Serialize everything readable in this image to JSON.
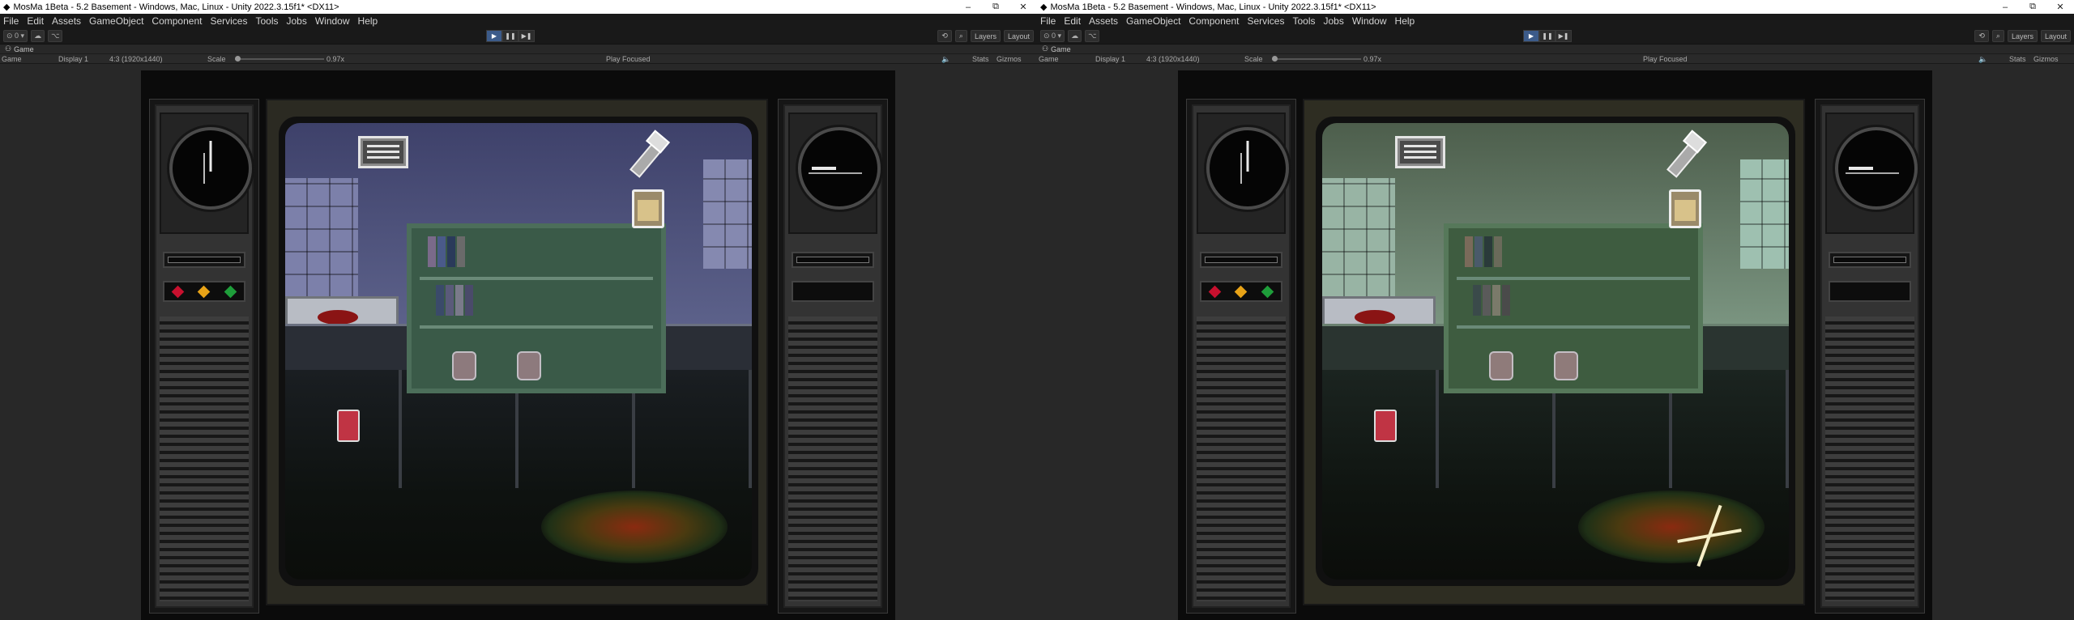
{
  "left": {
    "window_title": "MosMa 1Beta - 5.2 Basement - Windows, Mac, Linux - Unity 2022.3.15f1* <DX11>",
    "game_tab": "Game",
    "variant": "cold"
  },
  "right": {
    "window_title": "MosMa 1Beta - 5.2 Basement - Windows, Mac, Linux - Unity 2022.3.15f1* <DX11>",
    "game_tab": "Game",
    "variant": "green"
  },
  "window_controls": {
    "minimize": "–",
    "restore": "⧉",
    "close": "✕"
  },
  "menu": [
    "File",
    "Edit",
    "Assets",
    "GameObject",
    "Component",
    "Services",
    "Tools",
    "Jobs",
    "Window",
    "Help"
  ],
  "toolbar": {
    "account": "⊙ 0 ▾",
    "cloud": "☁",
    "layers": "Layers",
    "layout": "Layout"
  },
  "playbar": {
    "play": "▶",
    "pause": "❚❚",
    "step": "▶❚"
  },
  "gamebar": {
    "mode": "Game",
    "display": "Display 1",
    "aspect": "4:3 (1920x1440)",
    "scale_label": "Scale",
    "scale_value": "0.97x",
    "play_focused": "Play Focused",
    "stats": "Stats",
    "gizmos": "Gizmos"
  },
  "colors": {
    "led_red": "#c8102e",
    "led_orange": "#e8a317",
    "led_green": "#1e9e3a",
    "wall_cold": "#5a5f86",
    "wall_green": "#6f8a74",
    "play_active": "#3c5b8a"
  },
  "icons": {
    "briefcase": "briefcase-icon",
    "flashlight": "flashlight-icon",
    "jar": "jar-icon",
    "sparkle": "sparkle-icon"
  }
}
